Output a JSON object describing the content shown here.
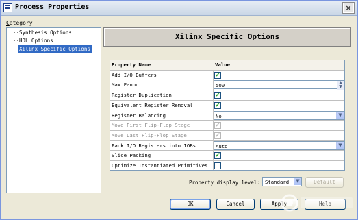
{
  "window": {
    "title": "Process Properties",
    "close_label": "×"
  },
  "category": {
    "label_prefix": "C",
    "label_rest": "ategory"
  },
  "tree": {
    "items": [
      {
        "label": "Synthesis Options",
        "selected": false
      },
      {
        "label": "HDL Options",
        "selected": false
      },
      {
        "label": "Xilinx Specific Options",
        "selected": true
      }
    ]
  },
  "header": {
    "title": "Xilinx Specific Options"
  },
  "table": {
    "col_property": "Property Name",
    "col_value": "Value",
    "rows": [
      {
        "name": "Add I/O Buffers",
        "type": "checkbox",
        "checked": true,
        "disabled": false
      },
      {
        "name": "Max Fanout",
        "type": "spinner",
        "value": "500",
        "disabled": false
      },
      {
        "name": "Register Duplication",
        "type": "checkbox",
        "checked": true,
        "disabled": false
      },
      {
        "name": "Equivalent Register Removal",
        "type": "checkbox",
        "checked": true,
        "disabled": false
      },
      {
        "name": "Register Balancing",
        "type": "dropdown",
        "value": "No",
        "disabled": false
      },
      {
        "name": "Move First Flip-Flop Stage",
        "type": "checkbox",
        "checked": true,
        "disabled": true
      },
      {
        "name": "Move Last Flip-Flop Stage",
        "type": "checkbox",
        "checked": true,
        "disabled": true
      },
      {
        "name": "Pack I/O Registers into IOBs",
        "type": "dropdown",
        "value": "Auto",
        "disabled": false
      },
      {
        "name": "Slice Packing",
        "type": "checkbox",
        "checked": true,
        "disabled": false
      },
      {
        "name": "Optimize Instantiated Primitives",
        "type": "checkbox",
        "checked": false,
        "disabled": false
      }
    ]
  },
  "display_level": {
    "label": "Property display level:",
    "value": "Standard"
  },
  "buttons": {
    "default": "Default",
    "ok": "OK",
    "cancel": "Cancel",
    "apply": "Apply",
    "help": "Help"
  },
  "colors": {
    "selection": "#316ac5",
    "check": "#21a121",
    "dialog_bg": "#ece9d8"
  }
}
